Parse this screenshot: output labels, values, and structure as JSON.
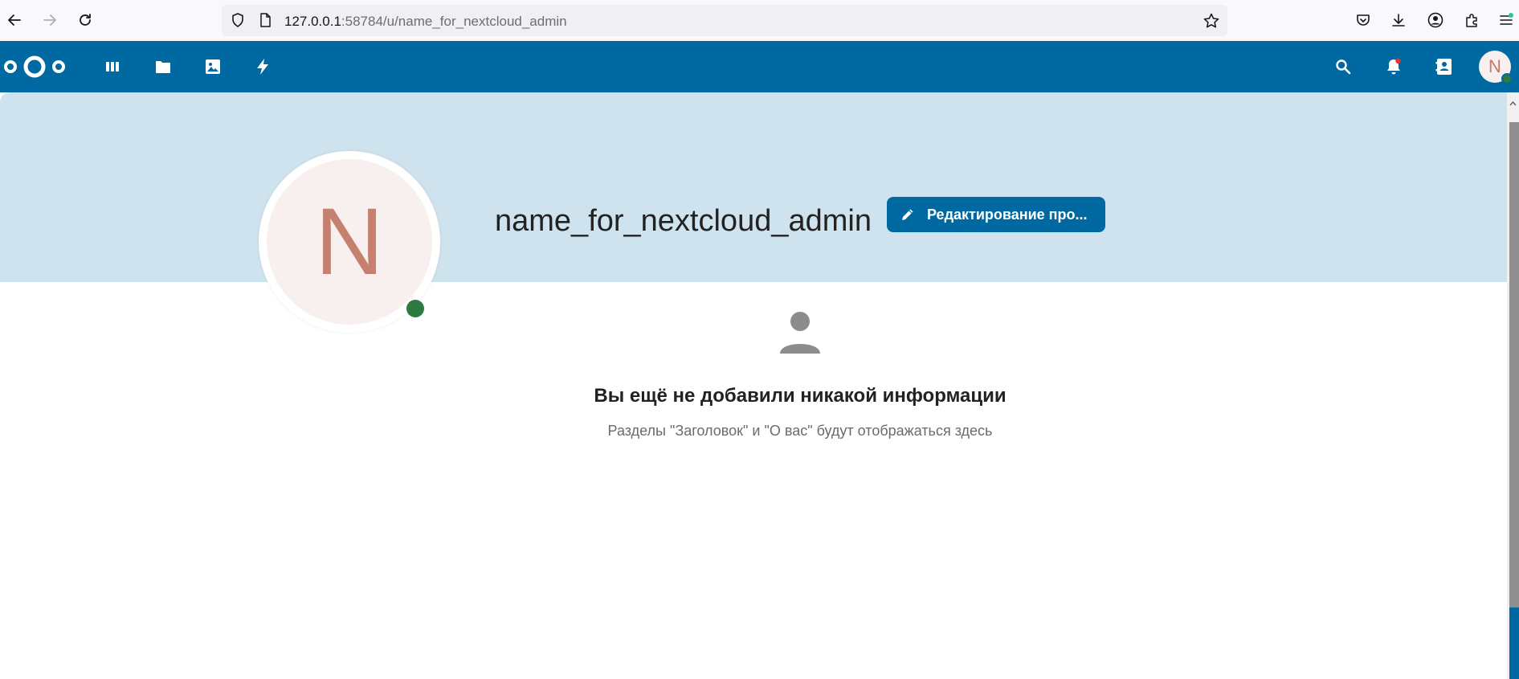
{
  "browser": {
    "url_host": "127.0.0.1",
    "url_rest": ":58784/u/name_for_nextcloud_admin",
    "icons": [
      "back-icon",
      "forward-icon",
      "reload-icon",
      "shield-icon",
      "page-icon",
      "bookmark-star-icon",
      "pocket-icon",
      "download-icon",
      "account-icon",
      "extensions-icon",
      "menu-icon"
    ]
  },
  "header": {
    "apps": [
      "dashboard-icon",
      "files-icon",
      "photos-icon",
      "activity-icon"
    ],
    "right_icons": [
      "search-icon",
      "notifications-icon",
      "contacts-icon"
    ],
    "avatar_letter": "N",
    "brand_color": "#0069a2"
  },
  "profile": {
    "avatar_letter": "N",
    "display_name": "name_for_nextcloud_admin",
    "edit_label": "Редактирование про...",
    "status_color": "#2d7b41"
  },
  "empty_state": {
    "title": "Вы ещё не добавили никакой информации",
    "description": "Разделы \"Заголовок\" и \"О вас\" будут отображаться здесь"
  }
}
